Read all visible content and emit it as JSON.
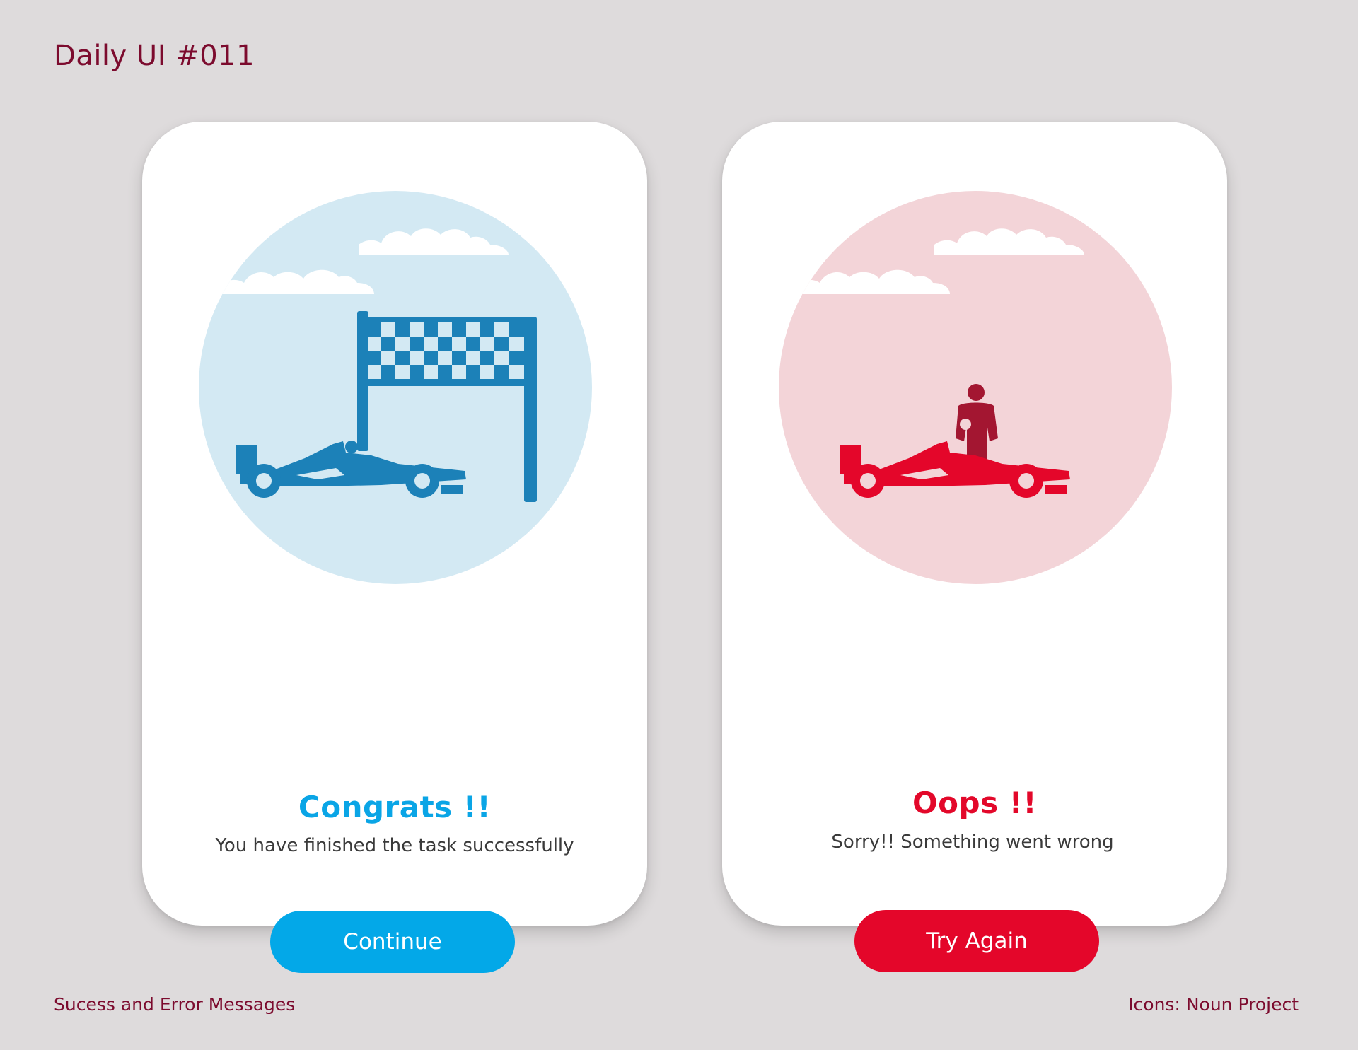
{
  "header": {
    "title": "Daily UI #011"
  },
  "success_card": {
    "title": "Congrats !!",
    "message": "You have finished the task successfully",
    "button_label": "Continue",
    "icon": "race-car-finish-line-icon"
  },
  "error_card": {
    "title": "Oops !!",
    "message": "Sorry!! Something went wrong",
    "button_label": "Try Again",
    "icon": "race-car-driver-icon"
  },
  "footer": {
    "left": "Sucess and Error Messages",
    "right": "Icons: Noun Project"
  },
  "colors": {
    "background": "#dedbdc",
    "accent_maroon": "#7c0b2e",
    "success_blue": "#03a8e8",
    "success_illustration_blue": "#1c81b8",
    "success_circle": "#d3e9f3",
    "error_red": "#e4062a",
    "error_circle": "#f3d4d8",
    "driver_dark_red": "#a31631"
  }
}
